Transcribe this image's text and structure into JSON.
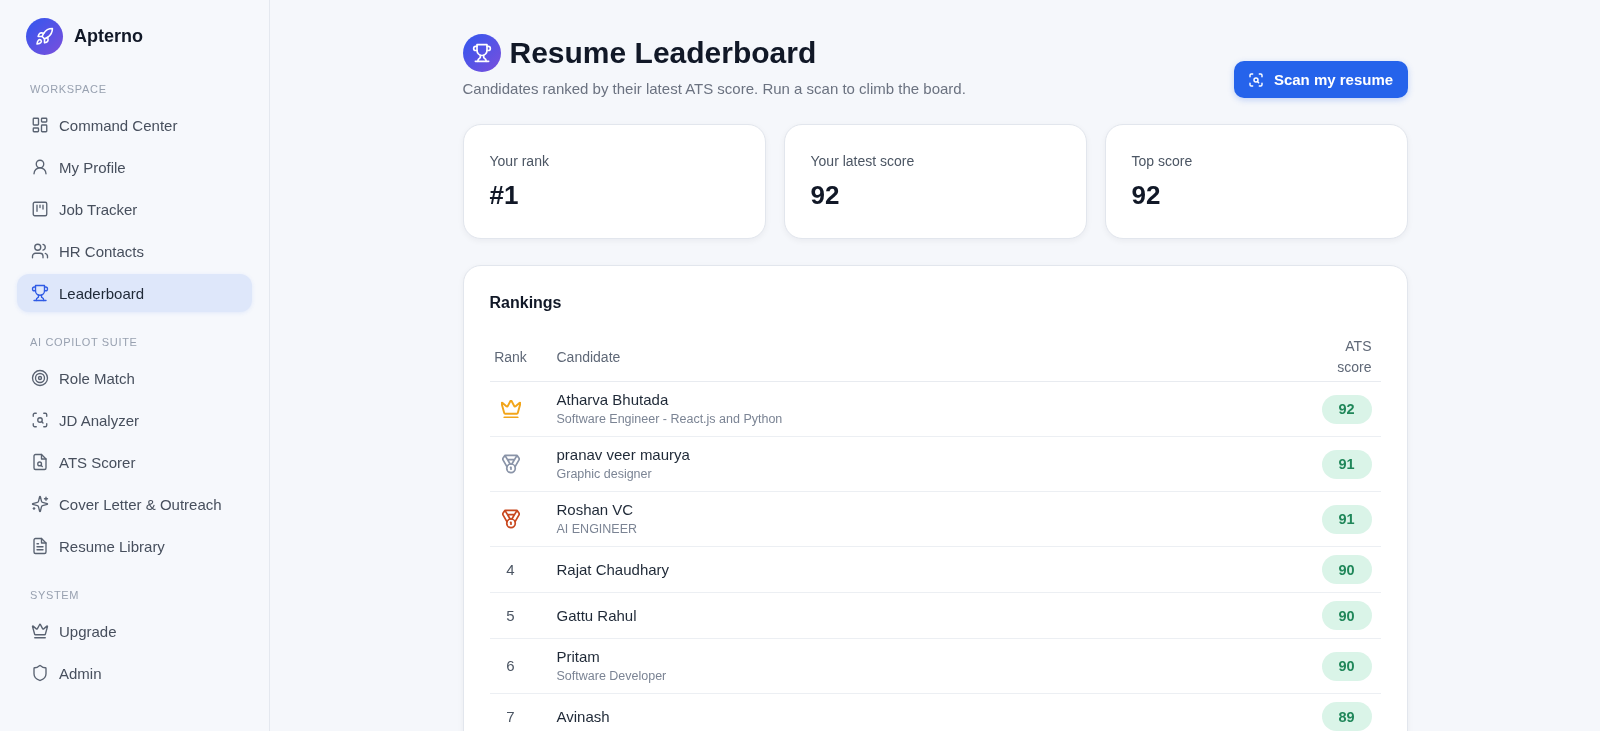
{
  "sidebar": {
    "brand": "Apterno",
    "sections": [
      {
        "title": "WORKSPACE",
        "items": [
          {
            "label": "Command Center",
            "selected": false
          },
          {
            "label": "My Profile",
            "selected": false
          },
          {
            "label": "Job Tracker",
            "selected": false
          },
          {
            "label": "HR Contacts",
            "selected": false
          },
          {
            "label": "Leaderboard",
            "selected": true
          }
        ]
      },
      {
        "title": "AI COPILOT SUITE",
        "items": [
          {
            "label": "Role Match",
            "selected": false
          },
          {
            "label": "JD Analyzer",
            "selected": false
          },
          {
            "label": "ATS Scorer",
            "selected": false
          },
          {
            "label": "Cover Letter & Outreach",
            "selected": false
          },
          {
            "label": "Resume Library",
            "selected": false
          }
        ]
      },
      {
        "title": "SYSTEM",
        "items": [
          {
            "label": "Upgrade",
            "selected": false
          },
          {
            "label": "Admin",
            "selected": false
          }
        ]
      }
    ]
  },
  "header": {
    "title": "Resume Leaderboard",
    "subtitle": "Candidates ranked by their latest ATS score. Run a scan to climb the board.",
    "button": "Scan my resume"
  },
  "stats": [
    {
      "label": "Your rank",
      "value": "#1"
    },
    {
      "label": "Your latest score",
      "value": "92"
    },
    {
      "label": "Top score",
      "value": "92"
    }
  ],
  "rankings": {
    "title": "Rankings",
    "columns": [
      "Rank",
      "Candidate",
      "ATS score"
    ],
    "rows": [
      {
        "kind": "crown",
        "color": "#f2a51a",
        "name": "Atharva Bhutada",
        "role": "Software Engineer - React.js and Python",
        "score": "92"
      },
      {
        "kind": "medal",
        "color": "#8a94a8",
        "name": "pranav veer maurya",
        "role": "Graphic designer",
        "score": "91"
      },
      {
        "kind": "medal",
        "color": "#c8481f",
        "name": "Roshan VC",
        "role": "AI ENGINEER",
        "score": "91"
      },
      {
        "kind": "number",
        "rank": "4",
        "name": "Rajat Chaudhary",
        "score": "90"
      },
      {
        "kind": "number",
        "rank": "5",
        "name": "Gattu Rahul",
        "score": "90"
      },
      {
        "kind": "number",
        "rank": "6",
        "name": "Pritam",
        "role": "Software Developer",
        "score": "90"
      },
      {
        "kind": "number",
        "rank": "7",
        "name": "Avinash",
        "score": "89"
      }
    ]
  }
}
